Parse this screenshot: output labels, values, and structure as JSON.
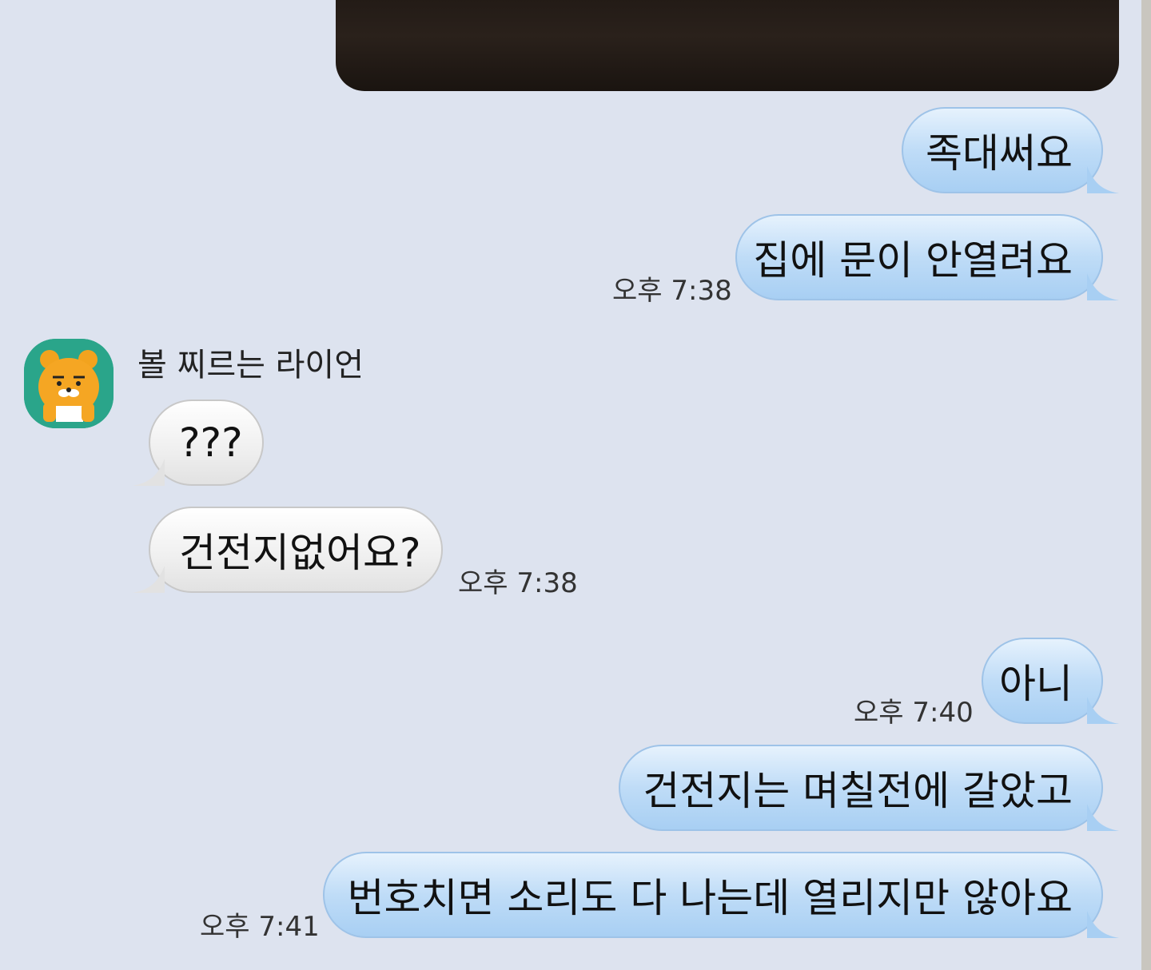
{
  "sender": {
    "name": "볼 찌르는 라이언"
  },
  "messages": [
    {
      "text": "족대써요",
      "time": ""
    },
    {
      "text": "집에 문이 안열려요",
      "time": "오후 7:38"
    },
    {
      "text": "???",
      "time": ""
    },
    {
      "text": "건전지없어요?",
      "time": "오후 7:38"
    },
    {
      "text": "아니",
      "time": "오후 7:40"
    },
    {
      "text": "건전지는 며칠전에 갈았고",
      "time": ""
    },
    {
      "text": "번호치면 소리도 다 나는데 열리지만 않아요",
      "time": "오후 7:41"
    }
  ],
  "icons": {
    "avatar": "ryan-character-icon"
  },
  "colors": {
    "background": "#dde3ef",
    "my_bubble": "#bfdcf7",
    "their_bubble": "#efefef",
    "avatar_bg": "#2aa58a"
  }
}
